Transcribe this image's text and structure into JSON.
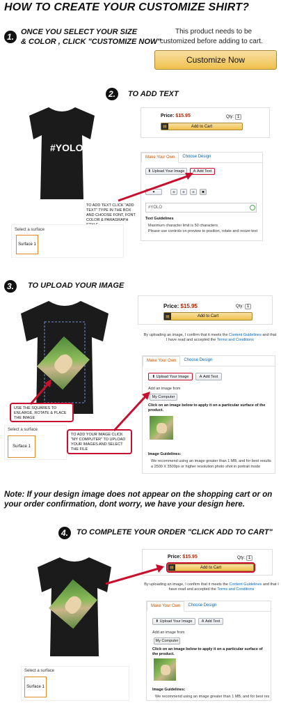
{
  "title": "HOW TO CREATE YOUR CUSTOMIZE SHIRT?",
  "step1": {
    "number": "1.",
    "text_line1": "ONCE YOU SELECT YOUR SIZE",
    "text_line2": "& COLOR , CLICK \"CUSTOMIZE NOW\"",
    "notice_line1": "This product needs to be",
    "notice_line2": "customized before adding to cart.",
    "button": "Customize Now"
  },
  "step2": {
    "number": "2.",
    "heading": "TO ADD TEXT",
    "shirt_text": "#YOLO",
    "price_label": "Price:",
    "price": "$15.95",
    "qty_label": "Qty:",
    "qty": "1",
    "add_to_cart": "Add to Cart",
    "tab_active": "Make Your Own",
    "tab_other": "Choose Design",
    "upload_btn": "Upload Your Image",
    "add_text_btn": "Add Text",
    "text_input": "#YOLO",
    "guidelines_title": "Text Guidelines",
    "guideline_1": "Maximum character limit is 50 characters",
    "guideline_2": "Please use controls on preview to position, rotate and resize text",
    "callout": "TO ADD TEXT CLICK \"ADD TEXT\" TYPE IN THE BOX AND CHOOSE FONT, FONT COLOR & PARAGRAPH STYLE",
    "surface_label": "Select a surface",
    "surface_item": "Surface 1"
  },
  "step3": {
    "number": "3.",
    "heading": "TO  UPLOAD YOUR IMAGE",
    "price_label": "Price:",
    "price": "$15.95",
    "qty_label": "Qty:",
    "qty": "1",
    "add_to_cart": "Add to Cart",
    "consent_1": "By uploading an image, I confirm that it meets the ",
    "consent_link1": "Content Guidelines",
    "consent_2": " and that",
    "consent_3": "I have read and accepted the ",
    "consent_link2": "Terms and Conditions",
    "tab_active": "Make Your Own",
    "tab_other": "Choose Design",
    "upload_btn": "Upload Your Image",
    "add_text_btn": "Add Text",
    "add_image_from": "Add an image from",
    "my_computer": "My Computer",
    "click_instruction": "Click on an image below to apply it on a particular surface of the product.",
    "guidelines_title": "Image Guidelines:",
    "guideline_1": "We recommend using an image greater than 1 MB, and for best results",
    "guideline_2": "a 2500 X 3500px or higher resolution photo shot in portrait mode",
    "callout_left": "USE THE SQUARES TO ENLARGE, ROTATE & PLACE THE IMAGE",
    "callout_right": "TO ADD YOUR IMAGE CLICK \"MY COMPUTER\" TO UPLOAD YOUR IMAGES AND SELECT THE FILE",
    "surface_label": "Select a surface",
    "surface_item": "Surface 1"
  },
  "note": "Note: If your design image does not appear on the shopping cart or on your order confirmation, dont worry, we have your design here.",
  "step4": {
    "number": "4.",
    "heading": "TO COMPLETE YOUR ORDER  \"CLICK ADD TO CART\"",
    "price_label": "Price:",
    "price": "$15.95",
    "qty_label": "Qty:",
    "qty": "1",
    "add_to_cart": "Add to Cart",
    "consent_1": "By uploading an image, I confirm that it meets the ",
    "consent_link1": "Content Guidelines",
    "consent_2": " and that I",
    "consent_3": "have read and accepted the ",
    "consent_link2": "Terms and Conditions",
    "tab_active": "Make Your Own",
    "tab_other": "Choose Design",
    "upload_btn": "Upload Your Image",
    "add_text_btn": "Add Text",
    "add_image_from": "Add an image from",
    "my_computer": "My Computer",
    "click_instruction": "Click on an image below to apply it on a particular surface of the product.",
    "guidelines_title": "Image Guidelines:",
    "guideline_1": "We recommend using an image greater than 1 MB, and for best results",
    "surface_label": "Select a surface",
    "surface_item": "Surface 1"
  },
  "colors": {
    "accent_red": "#c8102e",
    "price_red": "#b12704",
    "button_yellow": "#f0c14b",
    "link_blue": "#0066c0",
    "tab_orange": "#c45500",
    "shirt": "#1b1b1b"
  }
}
